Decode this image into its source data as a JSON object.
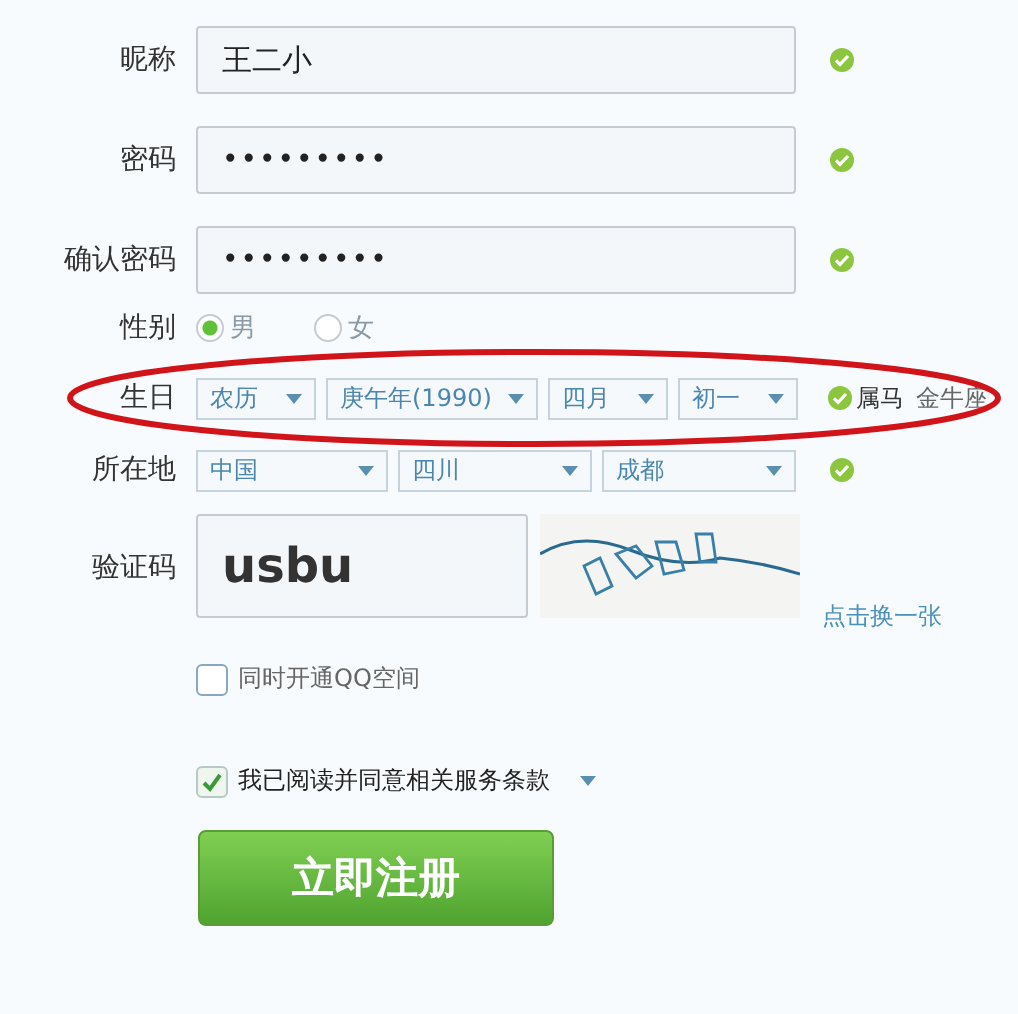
{
  "nickname": {
    "label": "昵称",
    "value": "王二小",
    "valid": true
  },
  "password": {
    "label": "密码",
    "value": "•••••••••",
    "valid": true
  },
  "confirm_password": {
    "label": "确认密码",
    "value": "•••••••••",
    "valid": true
  },
  "gender": {
    "label": "性别",
    "options": [
      {
        "label": "男",
        "selected": true
      },
      {
        "label": "女",
        "selected": false
      }
    ]
  },
  "birthday": {
    "label": "生日",
    "highlighted": true,
    "valid": true,
    "selects": [
      {
        "value": "农历"
      },
      {
        "value": "庚午年(1990)"
      },
      {
        "value": "四月"
      },
      {
        "value": "初一"
      }
    ],
    "zodiac": "属马",
    "star_sign": "金牛座"
  },
  "location": {
    "label": "所在地",
    "valid": true,
    "selects": [
      {
        "value": "中国"
      },
      {
        "value": "四川"
      },
      {
        "value": "成都"
      }
    ]
  },
  "captcha": {
    "label": "验证码",
    "value": "usbu",
    "refresh_link": "点击换一张"
  },
  "qzone": {
    "label": "同时开通QQ空间",
    "checked": false
  },
  "agreement": {
    "label": "我已阅读并同意相关服务条款",
    "checked": true
  },
  "submit_button": "立即注册"
}
